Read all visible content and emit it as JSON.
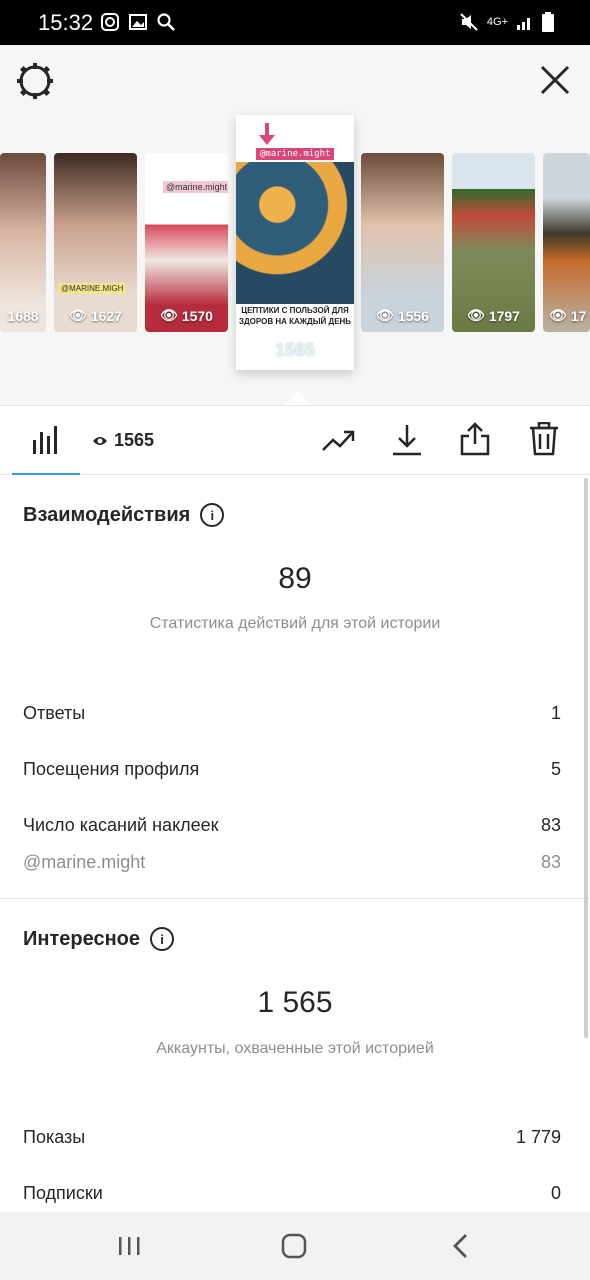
{
  "status_bar": {
    "time": "15:32",
    "network": "4G+"
  },
  "thumbnails": [
    {
      "views": "1688",
      "label": ""
    },
    {
      "views": "1627",
      "label": "@MARINE.MIGH"
    },
    {
      "views": "1570",
      "label": "@marine.might"
    },
    {
      "views": "1556",
      "label": ""
    },
    {
      "views": "1797",
      "label": ""
    },
    {
      "views": "17",
      "label": ""
    }
  ],
  "selected_story": {
    "handle": "@marine.might",
    "caption": "ЦЕПТИКИ С ПОЛЬЗОЙ ДЛЯ ЗДОРОВ НА КАЖДЫЙ ДЕНЬ",
    "views": "1565"
  },
  "toolbar": {
    "views": "1565"
  },
  "interactions": {
    "title": "Взаимодействия",
    "total": "89",
    "caption": "Статистика действий для этой истории",
    "rows": [
      {
        "label": "Ответы",
        "value": "1"
      },
      {
        "label": "Посещения профиля",
        "value": "5"
      },
      {
        "label": "Число касаний наклеек",
        "value": "83"
      },
      {
        "label": "@marine.might",
        "value": "83"
      }
    ]
  },
  "discovery": {
    "title": "Интересное",
    "total": "1 565",
    "caption": "Аккаунты, охваченные этой историей",
    "rows": [
      {
        "label": "Показы",
        "value": "1 779"
      },
      {
        "label": "Подписки",
        "value": "0"
      }
    ]
  },
  "colors": {
    "accent": "#3897f0",
    "muted": "#8e8e8e"
  }
}
